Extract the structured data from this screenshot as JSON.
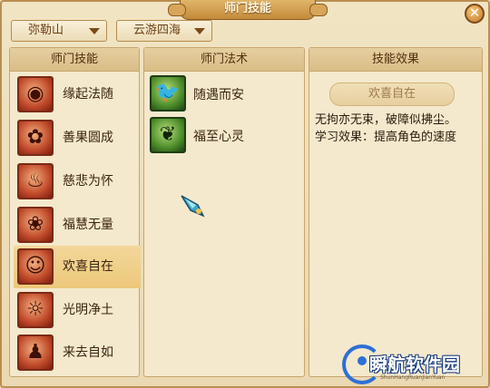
{
  "window": {
    "title": "师门技能",
    "close_symbol": "✕"
  },
  "filters": {
    "sect_value": "弥勒山",
    "region_value": "云游四海"
  },
  "skills_panel": {
    "header": "师门技能",
    "items": [
      {
        "label": "缘起法随",
        "icon": "lotus-hand-icon",
        "glyph": "◉"
      },
      {
        "label": "善果圆成",
        "icon": "fruit-icon",
        "glyph": "✿"
      },
      {
        "label": "慈悲为怀",
        "icon": "flame-pillar-icon",
        "glyph": "♨"
      },
      {
        "label": "福慧无量",
        "icon": "flower-icon",
        "glyph": "❀"
      },
      {
        "label": "欢喜自在",
        "icon": "buddha-icon",
        "glyph": "☺"
      },
      {
        "label": "光明净土",
        "icon": "sun-flame-icon",
        "glyph": "☼"
      },
      {
        "label": "来去自如",
        "icon": "figure-icon",
        "glyph": "♟"
      }
    ],
    "selected_index": 4
  },
  "spells_panel": {
    "header": "师门法术",
    "items": [
      {
        "label": "随遇而安",
        "icon": "bird-icon",
        "glyph": "🐦"
      },
      {
        "label": "福至心灵",
        "icon": "butterfly-icon",
        "glyph": "❦"
      }
    ]
  },
  "effect_panel": {
    "header": "技能效果",
    "skill_name": "欢喜自在",
    "description_line1": "无拘亦无束，破障似拂尘。",
    "description_line2": "学习效果：提高角色的速度"
  },
  "watermark": {
    "text": "瞬航软件园",
    "sub": "ShunHangRuanJianYuan"
  },
  "colors": {
    "accent": "#c48a3a",
    "selected_row": "#ecc87a",
    "skill_icon": "#c04a2a",
    "spell_icon": "#4d8d2b"
  }
}
